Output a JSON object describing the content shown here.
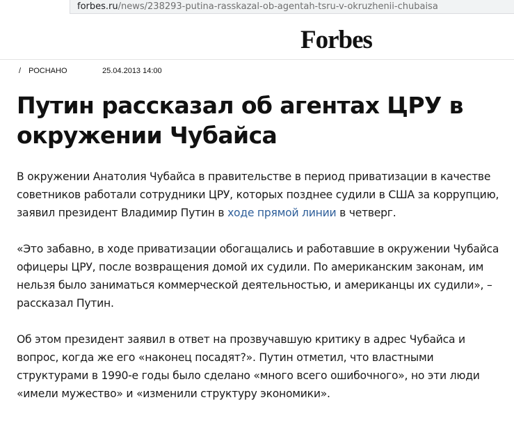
{
  "browser": {
    "url_domain": "forbes.ru",
    "url_path": "/news/238293-putina-rasskazal-ob-agentah-tsru-v-okruzhenii-chubaisa"
  },
  "header": {
    "logo_text": "Forbes"
  },
  "meta": {
    "slash": "/",
    "category": "РОСНАНО",
    "date": "25.04.2013 14:00"
  },
  "article": {
    "title": "Путин рассказал об агентах ЦРУ в окружении Чубайса",
    "p1_before_link": "В окружении Анатолия Чубайса в правительстве в период приватизации в качестве советников работали сотрудники ЦРУ, которых позднее судили в США за коррупцию, заявил президент Владимир Путин в ",
    "p1_link": "ходе прямой линии",
    "p1_after_link": " в четверг.",
    "p2": "«Это забавно, в ходе приватизации обогащались и работавшие в окружении Чубайса офицеры ЦРУ, после возвращения домой их судили. По американским законам, им нельзя было заниматься коммерческой деятельностью, и американцы их судили», – рассказал Путин.",
    "p3": "Об этом президент заявил в ответ на прозвучавшую критику в адрес Чубайса и вопрос, когда же его «наконец посадят?». Путин отметил, что властными структурами в 1990-е годы было сделано «много всего ошибочного», но эти люди «имели мужество» и «изменили структуру экономики»."
  },
  "colors": {
    "link": "#2f5f9a",
    "text": "#1a1a1a",
    "url_path": "#6f6f6f"
  }
}
